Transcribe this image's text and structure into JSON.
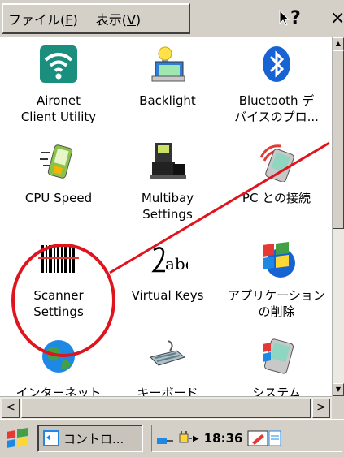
{
  "menubar": {
    "file_label": "ファイル(F)",
    "file_key": "F",
    "view_label": "表示(V)",
    "view_key": "V",
    "help_label": "?",
    "close_label": "×"
  },
  "items": [
    {
      "name": "aironet",
      "line1": "Aironet",
      "line2": "Client Utility"
    },
    {
      "name": "backlight",
      "line1": "Backlight",
      "line2": ""
    },
    {
      "name": "bluetooth",
      "line1": "Bluetooth デ",
      "line2": "バイスのプロ..."
    },
    {
      "name": "cpu-speed",
      "line1": "CPU Speed",
      "line2": ""
    },
    {
      "name": "multibay",
      "line1": "Multibay",
      "line2": "Settings"
    },
    {
      "name": "pc-connection",
      "line1": "PC との接続",
      "line2": ""
    },
    {
      "name": "scanner",
      "line1": "Scanner",
      "line2": "Settings"
    },
    {
      "name": "virtual-keys",
      "line1": "Virtual Keys",
      "line2": ""
    },
    {
      "name": "remove-programs",
      "line1": "アプリケーション",
      "line2": "の削除"
    },
    {
      "name": "internet",
      "line1": "インターネット",
      "line2": ""
    },
    {
      "name": "keyboard",
      "line1": "キーボード",
      "line2": ""
    },
    {
      "name": "system",
      "line1": "システム",
      "line2": ""
    }
  ],
  "scrollbar": {
    "left_arrow": "<",
    "right_arrow": ">",
    "up_arrow": "▲",
    "down_arrow": "▼"
  },
  "taskbar": {
    "window_label": "コントロ...",
    "clock": "18:36"
  },
  "colors": {
    "annotation_red": "#e0141e",
    "chrome": "#d4d0c8",
    "aironet_teal": "#1a8f7e",
    "bluetooth_blue": "#1763d4"
  }
}
